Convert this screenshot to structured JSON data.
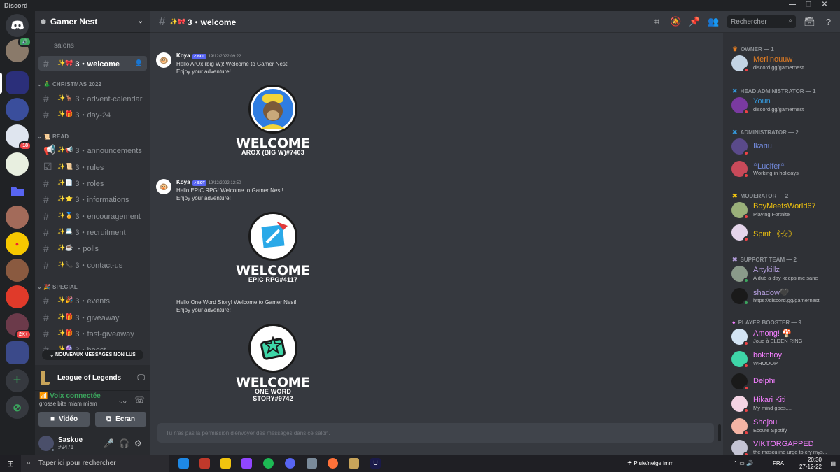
{
  "titlebar": {
    "title": "Discord"
  },
  "server": {
    "name": "Gamer Nest",
    "subtitle_fragment": "salons"
  },
  "channels": {
    "active": {
      "label": "3・welcome",
      "emoji": "✨🎀"
    },
    "categories": [
      {
        "label": "CHRISTMAS 2022",
        "emoji": "🎄"
      },
      {
        "label": "READ",
        "emoji": "📜"
      },
      {
        "label": "SPECIAL",
        "emoji": "🎉"
      }
    ],
    "christmas": [
      {
        "label": "3・advent-calendar",
        "emoji": "✨🦌"
      },
      {
        "label": "3・day-24",
        "emoji": "✨🎁"
      }
    ],
    "read": [
      {
        "label": "3・announcements",
        "emoji": "✨📢"
      },
      {
        "label": "3・rules",
        "emoji": "✨📜"
      },
      {
        "label": "3・roles",
        "emoji": "✨📄"
      },
      {
        "label": "3・informations",
        "emoji": "✨⭐"
      },
      {
        "label": "3・encouragement",
        "emoji": "✨🏅"
      },
      {
        "label": "3・recruitment",
        "emoji": "✨📇"
      },
      {
        "label": "・polls",
        "emoji": "✨☕"
      },
      {
        "label": "3・contact-us",
        "emoji": "✨📞"
      }
    ],
    "special": [
      {
        "label": "3・events",
        "emoji": "✨🎉"
      },
      {
        "label": "3・giveaway",
        "emoji": "✨🎁"
      },
      {
        "label": "3・fast-giveaway",
        "emoji": "✨🎁"
      },
      {
        "label": "3・boost",
        "emoji": "✨🔮"
      }
    ]
  },
  "new_messages_label": "NOUVEAUX MESSAGES NON LUS",
  "activity": {
    "game": "League of Legends"
  },
  "voice": {
    "status": "Voix connectée",
    "channel": "grosse bite miam miam",
    "video_label": "Vidéo",
    "screen_label": "Écran"
  },
  "user": {
    "name": "Saskue",
    "tag": "#9471"
  },
  "header": {
    "channel": "3・welcome",
    "channel_emoji": "✨🎀",
    "search_placeholder": "Rechercher"
  },
  "messages": [
    {
      "author": "Koya",
      "bot_tag": "BOT",
      "time": "19/12/2022 09:22",
      "line1": "Hello ArOx (big W)! Welcome to Gamer Nest!",
      "line2": "Enjoy your adventure!",
      "card_title": "WELCOME",
      "card_sub": "AROX (BIG W)#7403"
    },
    {
      "author": "Koya",
      "bot_tag": "BOT",
      "time": "19/12/2022 12:50",
      "line1": "Hello EPIC RPG! Welcome to Gamer Nest!",
      "line2": "Enjoy your adventure!",
      "card_title": "WELCOME",
      "card_sub": "EPIC RPG#4117"
    },
    {
      "line1": "Hello One Word Story! Welcome to Gamer Nest!",
      "line2": "Enjoy your adventure!",
      "card_title": "WELCOME",
      "card_sub": "ONE WORD STORY#9742"
    }
  ],
  "input_placeholder": "Tu n'as pas la permission d'envoyer des messages dans ce salon.",
  "members": {
    "roles": [
      {
        "label": "OWNER — 1"
      },
      {
        "label": "HEAD ADMINISTRATOR — 1"
      },
      {
        "label": "ADMINISTRATOR — 2"
      },
      {
        "label": "MODERATOR — 2"
      },
      {
        "label": "SUPPORT TEAM — 2"
      },
      {
        "label": "PLAYER BOOSTER — 9"
      }
    ],
    "list": [
      {
        "name": "Merlinouuw",
        "status": "discord.gg/gamernest",
        "color": "#e67e22"
      },
      {
        "name": "Youn",
        "status": "discord.gg/gamernest",
        "color": "#3498db"
      },
      {
        "name": "Ikariu",
        "status": "",
        "color": "#7289da"
      },
      {
        "name": "꙳Lucifer꙳",
        "status": "Working in holidays",
        "color": "#7289da"
      },
      {
        "name": "BoyMeetsWorld67",
        "status": "Playing Fortnite",
        "color": "#f1c40f"
      },
      {
        "name": "Spirit 《☆》",
        "status": "",
        "color": "#f1c40f"
      },
      {
        "name": "Artykillz",
        "status": "A dub a day keeps me sane",
        "color": "#b39ddb"
      },
      {
        "name": "shadow🖤",
        "status": "https://discord.gg/gamernest",
        "color": "#b39ddb"
      },
      {
        "name": "Among! 🍄",
        "status": "Joue à ELDEN RING",
        "color": "#f47fff"
      },
      {
        "name": "bokchoy",
        "status": "WHOOOP",
        "color": "#f47fff"
      },
      {
        "name": "Delphi",
        "status": "",
        "color": "#f47fff"
      },
      {
        "name": "Hikari Kiti",
        "status": "My mind goes....",
        "color": "#f47fff"
      },
      {
        "name": "Shojou",
        "status": "Ecoute Spotify",
        "color": "#f47fff"
      },
      {
        "name": "VIKTORGAPPED",
        "status": "the masculine urge to cry mys...",
        "color": "#f47fff"
      }
    ]
  },
  "taskbar": {
    "search_placeholder": "Taper ici pour rechercher",
    "weather": "Pluie/neige imm",
    "lang": "FRA",
    "time": "20:30",
    "date": "27-12-22"
  },
  "colors": {
    "accent": "#5865f2",
    "online": "#3ba55d",
    "dnd": "#ed4245"
  }
}
